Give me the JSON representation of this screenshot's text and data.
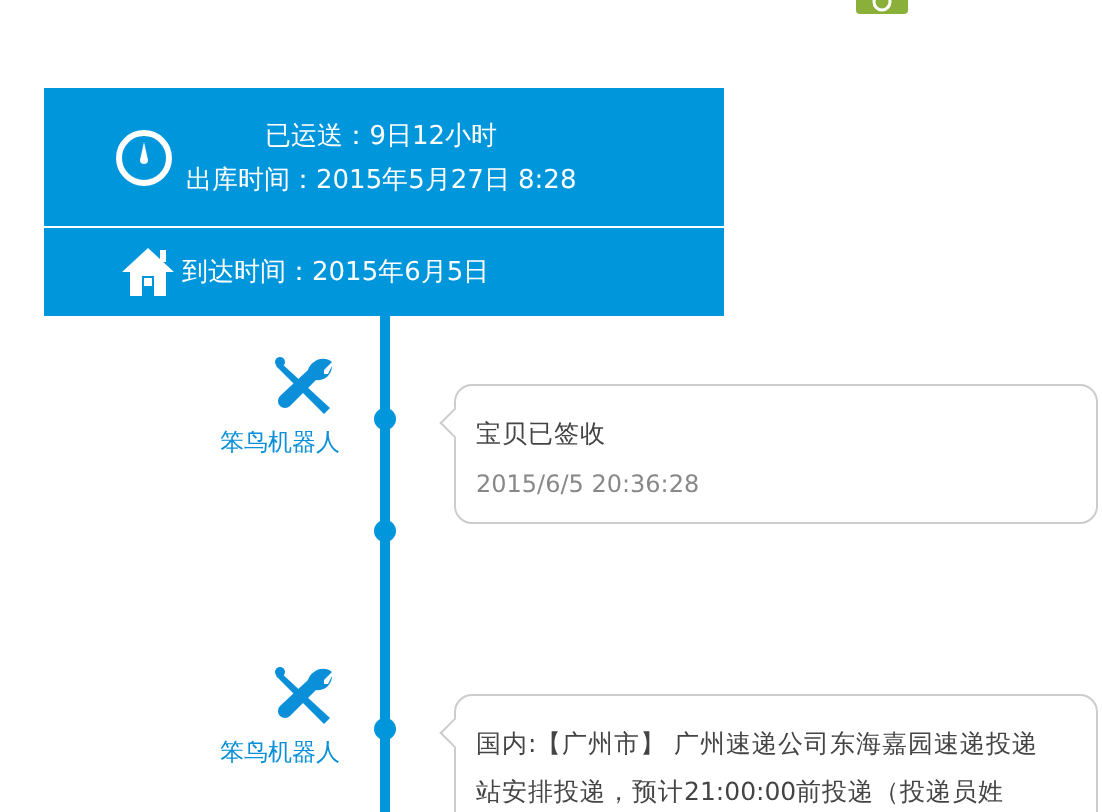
{
  "summary": {
    "transit": "已运送：9日12小时",
    "shipped": "出库时间：2015年5月27日 8:28",
    "arrival": "到达时间：2015年6月5日"
  },
  "events": [
    {
      "actor": "笨鸟机器人",
      "message": "宝贝已签收",
      "time": "2015/6/5 20:36:28"
    },
    {
      "actor": "笨鸟机器人",
      "message": "国内:【广州市】 广州速递公司东海嘉园速递投递站安排投递，预计21:00:00前投递（投递员姓"
    }
  ]
}
